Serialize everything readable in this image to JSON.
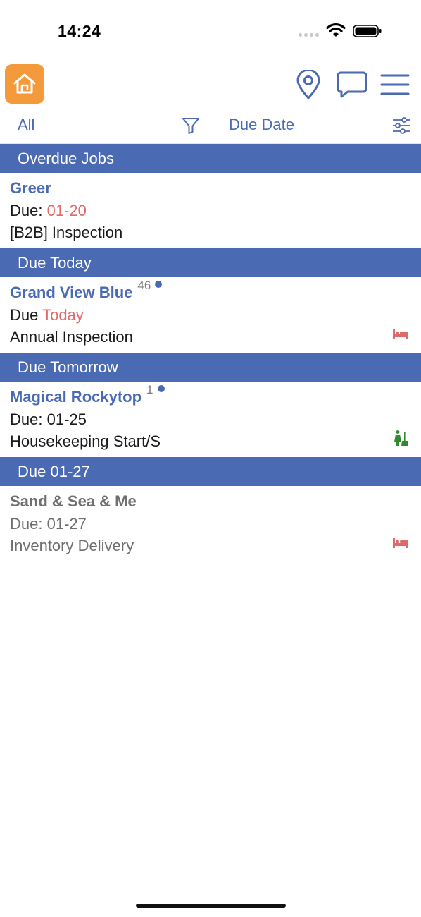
{
  "status_bar": {
    "time": "14:24"
  },
  "header": {
    "logo_icon": "home-logo-icon",
    "actions": [
      "map-pin-icon",
      "chat-icon",
      "menu-icon"
    ]
  },
  "filter_bar": {
    "filter_label": "All",
    "sort_label": "Due Date"
  },
  "colors": {
    "accent": "#4a6ab3",
    "logo": "#f59a3a",
    "highlight": "#e06a6a",
    "housekeeping": "#2e8b2e"
  },
  "sections": [
    {
      "title": "Overdue Jobs",
      "jobs": [
        {
          "name": "Greer",
          "due_prefix": "Due: ",
          "due_value": "01-20",
          "type": "[B2B] Inspection"
        }
      ]
    },
    {
      "title": "Due Today",
      "jobs": [
        {
          "name": "Grand View Blue",
          "count": "46",
          "due_prefix": "Due ",
          "due_value": "Today",
          "type": "Annual Inspection",
          "badge": "bed-icon"
        }
      ]
    },
    {
      "title": "Due Tomorrow",
      "jobs": [
        {
          "name": "Magical Rockytop",
          "count": "1",
          "due_prefix": "Due: ",
          "due_value": "01-25",
          "type": "Housekeeping Start/S",
          "badge": "housekeeping-icon"
        }
      ]
    },
    {
      "title": "Due 01-27",
      "jobs": [
        {
          "name": "Sand & Sea & Me",
          "due_prefix": "Due: ",
          "due_value": "01-27",
          "type": "Inventory Delivery",
          "badge": "bed-icon"
        }
      ]
    }
  ]
}
